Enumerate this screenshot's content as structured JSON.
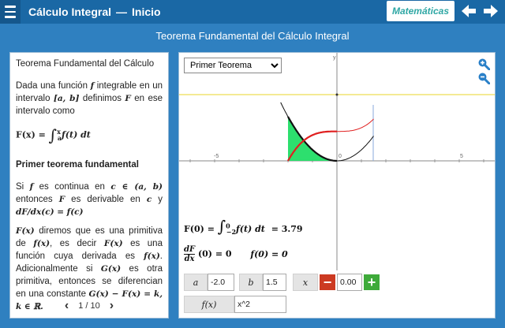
{
  "header": {
    "app_title": "Cálculo Integral",
    "separator": "—",
    "section": "Inicio",
    "subject": "Matemáticas"
  },
  "page_heading": "Teorema Fundamental del Cálculo Integral",
  "left_panel": {
    "title": "Teorema Fundamental del Cálculo",
    "intro_1": "Dada una función ",
    "intro_f": "f",
    "intro_2": " integrable en un intervalo ",
    "intro_ab": "[a, b]",
    "intro_3": " definimos ",
    "intro_F": "F",
    "intro_4": " en ese intervalo como",
    "def_lhs": "F(x) = ",
    "def_sup": "x",
    "def_sub": "a",
    "def_rhs": "f(t)  dt",
    "subtitle": "Primer teorema fundamental",
    "p1_a": "Si ",
    "p1_f": "f",
    "p1_b": " es continua en ",
    "p1_c": "c ∈ (a, b)",
    "p1_d": " entonces ",
    "p1_F": "F",
    "p1_e": " es derivable en ",
    "p1_c2": "c",
    "p1_y": " y ",
    "p1_deriv": "dF/dx(c) = f(c)",
    "p2_Fx": "F(x)",
    "p2_a": " diremos que es una primitiva de ",
    "p2_fx": "f(x)",
    "p2_b": ", es decir ",
    "p2_Fx2": "F(x)",
    "p2_c": " es una función cuya derivada es ",
    "p2_fx2": "f(x)",
    "p2_d": ". Adicionalmente si ",
    "p2_Gx": "G(x)",
    "p2_e": " es otra primitiva, entonces se diferencian en una constante ",
    "p2_eq": "G(x) − F(x) = k, k ∈ ℝ.",
    "pager": "1 / 10"
  },
  "graph": {
    "select_value": "Primer Teorema",
    "select_options": [
      "Primer Teorema"
    ],
    "y_axis_label": "y",
    "x_tick_labels": [
      "-5",
      "0",
      "5"
    ],
    "result_lhs": "F(0) = ",
    "result_upper": "0",
    "result_lower": "−2",
    "result_integrand": "f(t) dt",
    "result_value": "= 3.79",
    "deriv_num": "dF",
    "deriv_den": "dx",
    "deriv_eval": "(0) = 0",
    "f_eval": "f(0) = 0",
    "colors": {
      "area_fill": "#22dd66",
      "primitive_curve": "#e02020",
      "function_curve": "#111111",
      "level_line": "#eedd55",
      "bound_line": "#88aadd"
    }
  },
  "controls": {
    "a_label": "a",
    "a_value": "-2.0",
    "b_label": "b",
    "b_value": "1.5",
    "x_label": "x",
    "x_value": "0.00",
    "minus_label": "−",
    "plus_label": "+",
    "fx_label": "f(x)",
    "fx_value": "x^2"
  }
}
